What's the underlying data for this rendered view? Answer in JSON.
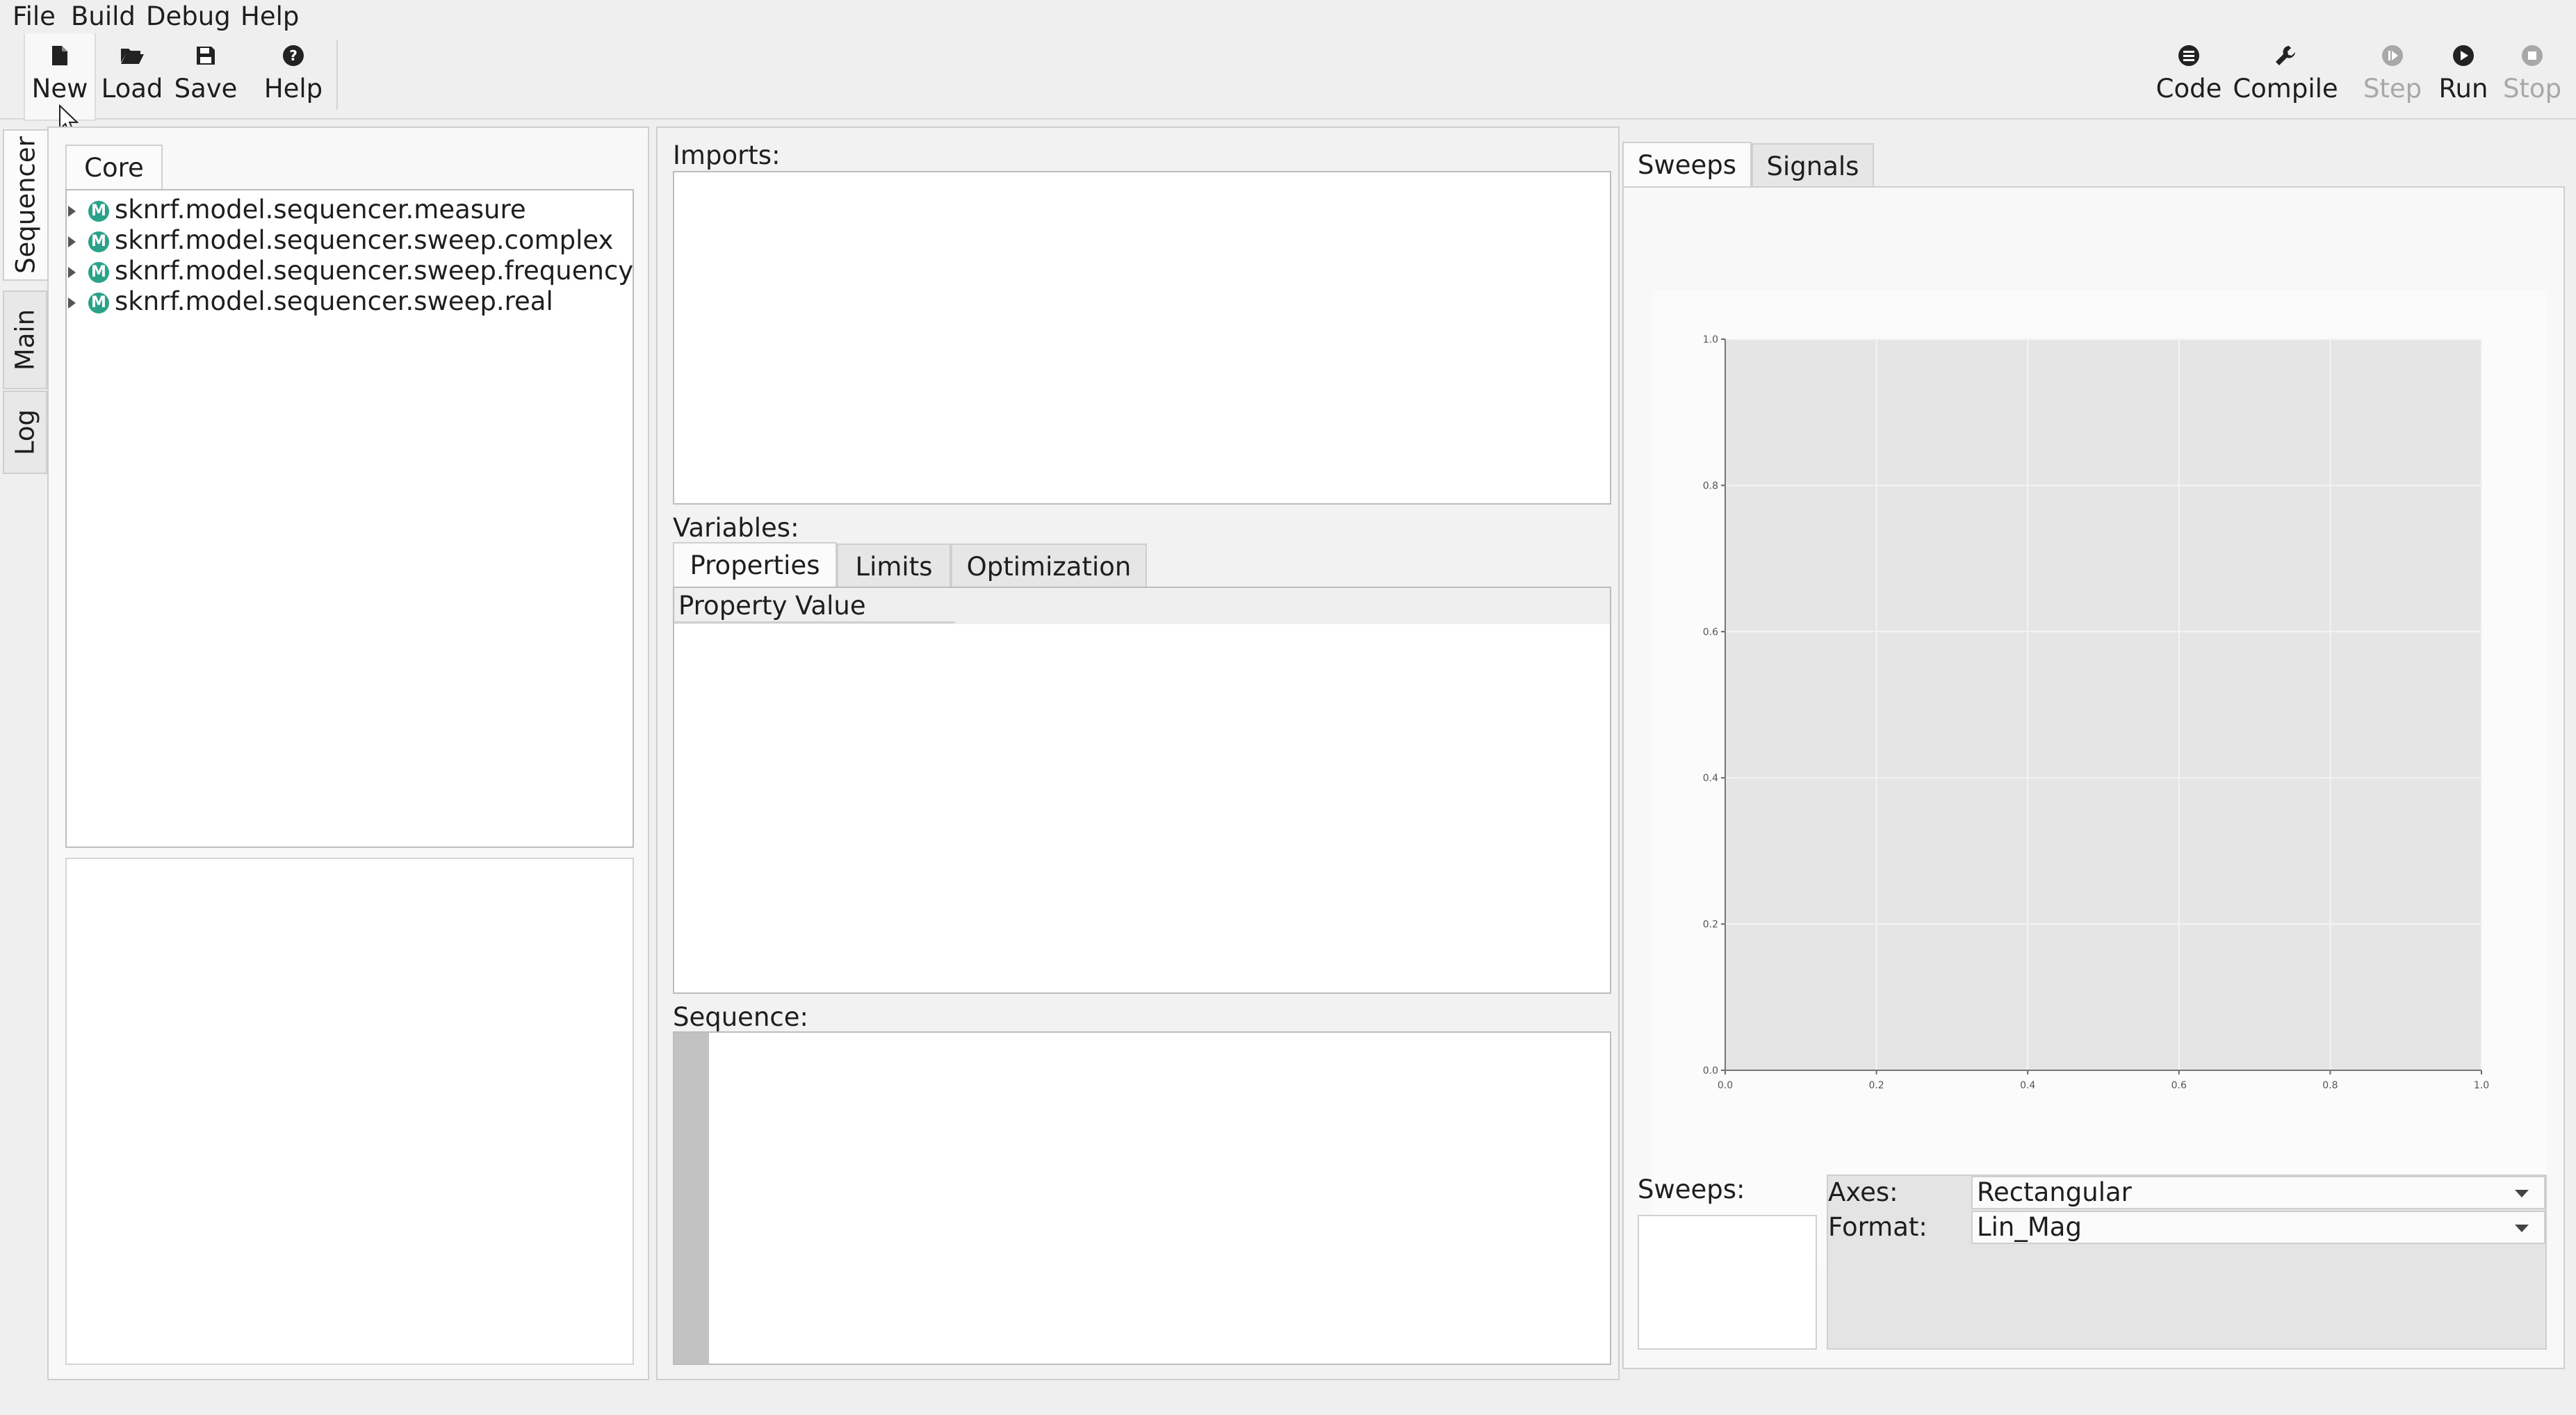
{
  "menubar": {
    "items": [
      "File",
      "Build",
      "Debug",
      "Help"
    ]
  },
  "toolbar": {
    "left": [
      {
        "label": "New",
        "icon": "file-new-icon"
      },
      {
        "label": "Load",
        "icon": "folder-open-icon"
      },
      {
        "label": "Save",
        "icon": "floppy-disk-icon"
      },
      {
        "label": "Help",
        "icon": "question-circle-icon"
      }
    ],
    "right": [
      {
        "label": "Code",
        "icon": "list-icon"
      },
      {
        "label": "Compile",
        "icon": "wrench-icon"
      },
      {
        "label": "Step",
        "icon": "step-icon",
        "disabled": true
      },
      {
        "label": "Run",
        "icon": "play-icon"
      },
      {
        "label": "Stop",
        "icon": "stop-icon",
        "disabled": true
      }
    ]
  },
  "side_tabs": [
    "Sequencer",
    "Main",
    "Log"
  ],
  "left_panel": {
    "tab": "Core",
    "tree": [
      "sknrf.model.sequencer.measure",
      "sknrf.model.sequencer.sweep.complex",
      "sknrf.model.sequencer.sweep.frequency",
      "sknrf.model.sequencer.sweep.real"
    ],
    "module_badge": "M"
  },
  "middle_panel": {
    "imports_label": "Imports:",
    "variables_label": "Variables:",
    "variable_tabs": [
      "Properties",
      "Limits",
      "Optimization"
    ],
    "table_headers": [
      "Property",
      "Value"
    ],
    "sequence_label": "Sequence:"
  },
  "right_panel": {
    "tabs": [
      "Sweeps",
      "Signals"
    ],
    "plot_tools": [
      "download-icon",
      "undo-icon",
      "redo-icon",
      "zoom-in-icon",
      "zoom-out-icon",
      "zoom-fit-icon",
      "eye-icon",
      "pin-icon",
      "close-x-icon"
    ],
    "sweeps_label": "Sweeps:",
    "axes_label": "Axes:",
    "axes_value": "Rectangular",
    "format_label": "Format:",
    "format_value": "Lin_Mag"
  },
  "chart_data": {
    "type": "scatter",
    "x": [],
    "y": [],
    "xlim": [
      0.0,
      1.0
    ],
    "ylim": [
      0.0,
      1.0
    ],
    "xticks": [
      "0.0",
      "0.2",
      "0.4",
      "0.6",
      "0.8",
      "1.0"
    ],
    "yticks": [
      "0.0",
      "0.2",
      "0.4",
      "0.6",
      "0.8",
      "1.0"
    ],
    "grid": true,
    "background": "#e5e5e5"
  }
}
